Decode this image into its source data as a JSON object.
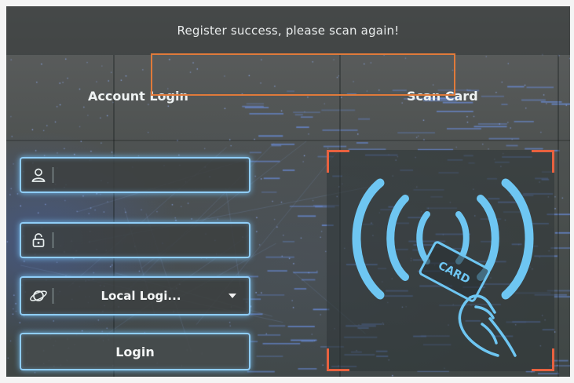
{
  "banner": {
    "message": "Register success, please scan again!"
  },
  "tabs": [
    {
      "label": "Account Login"
    },
    {
      "label": "Scan Card"
    }
  ],
  "form": {
    "username": {
      "value": "",
      "placeholder": "",
      "icon": "user-icon"
    },
    "password": {
      "value": "",
      "placeholder": "",
      "icon": "lock-icon"
    },
    "login_mode": {
      "selected": "Local Logi...",
      "icon": "planet-icon"
    },
    "login_button": "Login"
  },
  "card_panel": {
    "card_text": "CARD",
    "icons": [
      "card-scan-icon",
      "hand-holding-card-icon"
    ]
  },
  "colors": {
    "field_border": "#8fcdf7",
    "frame_corner": "#e8613f",
    "highlight": "#e07a3a",
    "signal_waves": "#6ec6f2"
  }
}
